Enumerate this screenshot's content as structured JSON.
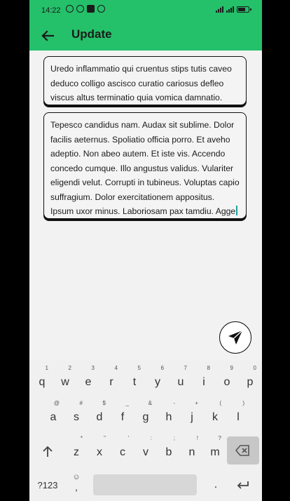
{
  "status_bar": {
    "time": "14:22"
  },
  "app_bar": {
    "title": "Update"
  },
  "fields": {
    "summary": "Uredo inflammatio qui cruentus stips tutis caveo deduco colligo ascisco curatio cariosus defleo viscus altus terminatio quia vomica damnatio.",
    "body": "Tepesco candidus nam. Audax sit sublime. Dolor facilis aeternus. Spoliatio officia porro. Et aveho adeptio. Non abeo autem. Et iste vis. Accendo concedo cumque. Illo angustus validus. Vulariter eligendi velut. Corrupti in tubineus. Voluptas capio suffragium. Dolor exercitationem appositus. Ipsum uxor minus. Laboriosam pax tamdiu. Agge"
  },
  "keyboard": {
    "row1": [
      {
        "k": "q",
        "h": "1"
      },
      {
        "k": "w",
        "h": "2"
      },
      {
        "k": "e",
        "h": "3"
      },
      {
        "k": "r",
        "h": "4"
      },
      {
        "k": "t",
        "h": "5"
      },
      {
        "k": "y",
        "h": "6"
      },
      {
        "k": "u",
        "h": "7"
      },
      {
        "k": "i",
        "h": "8"
      },
      {
        "k": "o",
        "h": "9"
      },
      {
        "k": "p",
        "h": "0"
      }
    ],
    "row2": [
      {
        "k": "a",
        "h": "@"
      },
      {
        "k": "s",
        "h": "#"
      },
      {
        "k": "d",
        "h": "$"
      },
      {
        "k": "f",
        "h": "_"
      },
      {
        "k": "g",
        "h": "&"
      },
      {
        "k": "h",
        "h": "-"
      },
      {
        "k": "j",
        "h": "+"
      },
      {
        "k": "k",
        "h": "("
      },
      {
        "k": "l",
        "h": ")"
      }
    ],
    "row3": [
      {
        "k": "z",
        "h": "*"
      },
      {
        "k": "x",
        "h": "\""
      },
      {
        "k": "c",
        "h": "'"
      },
      {
        "k": "v",
        "h": ":"
      },
      {
        "k": "b",
        "h": ";"
      },
      {
        "k": "n",
        "h": "!"
      },
      {
        "k": "m",
        "h": "?"
      }
    ],
    "symbols_label": "?123",
    "comma": ",",
    "period": "."
  },
  "icons": {
    "back": "arrow-left-icon",
    "send": "paper-plane-icon",
    "shift": "shift-arrow-icon",
    "backspace": "backspace-icon",
    "enter": "enter-icon",
    "emoji": "emoji-icon"
  },
  "colors": {
    "accent": "#25c06a"
  }
}
